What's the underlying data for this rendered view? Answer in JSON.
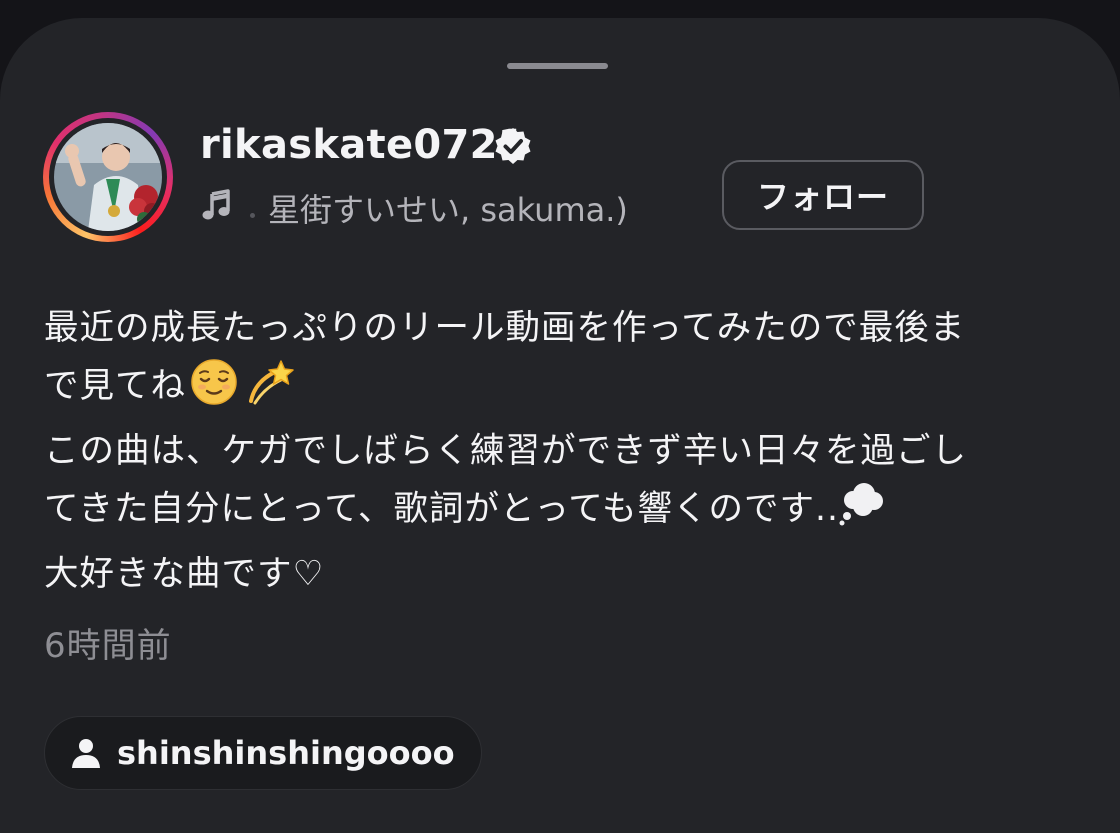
{
  "sheet": {
    "grabber": "drag-handle"
  },
  "profile": {
    "username": "rikaskate0721",
    "verified_icon": "verified-badge-icon",
    "music_icon": "music-note-icon",
    "music_text": "星街すいせい, sakuma.)",
    "follow_label": "フォロー"
  },
  "caption": {
    "line1": "最近の成長たっぷりのリール動画を作ってみたので最後ま",
    "line2_text": "で見てね",
    "line2_emojis": [
      "relieved-face-emoji",
      "dizzy-emoji"
    ],
    "line3": "この曲は、ケガでしばらく練習ができず辛い日々を過ごし",
    "line4_text": "てきた自分にとって、歌詞がとっても響くのです..",
    "line4_emoji": "thought-balloon-emoji",
    "line5": "大好きな曲です♡"
  },
  "timestamp": "6時間前",
  "tagged_user": {
    "icon": "person-icon",
    "label": "shinshinshingoooo"
  },
  "colors": {
    "background": "#232428",
    "text": "#f4f4f6",
    "muted": "#8e8e94",
    "story_ring": [
      "#fdc468",
      "#f77737",
      "#e1306c",
      "#833ab4"
    ]
  }
}
